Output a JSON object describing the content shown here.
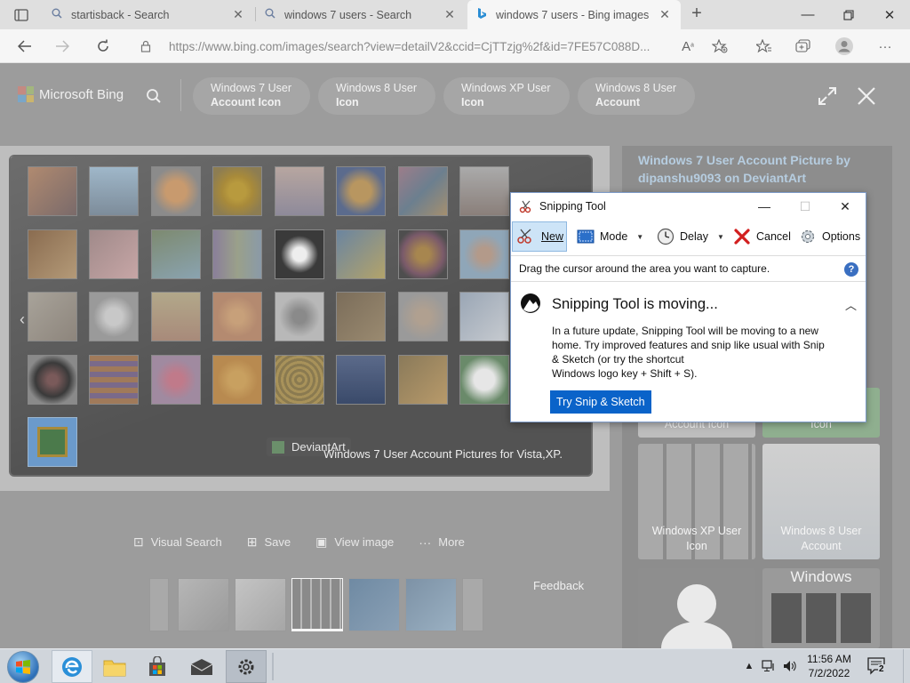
{
  "browser": {
    "tabs": [
      {
        "title": "startisback - Search",
        "active": false
      },
      {
        "title": "windows 7 users - Search",
        "active": false
      },
      {
        "title": "windows 7 users - Bing images",
        "active": true
      }
    ],
    "url": "https://www.bing.com/images/search?view=detailV2&ccid=CjTTzjg%2f&id=7FE57C088D..."
  },
  "bing": {
    "logo_text": "Microsoft Bing",
    "related": [
      {
        "line1": "Windows 7 User",
        "line2": "Account Icon"
      },
      {
        "line1": "Windows 8 User",
        "line2": "Icon"
      },
      {
        "line1": "Windows XP User",
        "line2": "Icon"
      },
      {
        "line1": "Windows 8 User",
        "line2": "Account"
      }
    ],
    "image": {
      "source": "DeviantArt",
      "caption": "Windows 7 User Account Pictures for Vista,XP."
    },
    "actions": {
      "visual_search": "Visual Search",
      "save": "Save",
      "view_image": "View image",
      "more": "More"
    },
    "feedback": "Feedback",
    "side": {
      "title": "Windows 7 User Account Picture by dipanshu9093 on DeviantArt",
      "cards": [
        {
          "label1": "Account Icon",
          "label2": ""
        },
        {
          "label1": "Icon",
          "label2": ""
        },
        {
          "label1": "Windows XP User",
          "label2": "Icon"
        },
        {
          "label1": "Windows 8 User",
          "label2": "Account"
        },
        {
          "label1": "",
          "label2": ""
        },
        {
          "label1": "Windows",
          "label2": ""
        }
      ]
    }
  },
  "snipping_tool": {
    "title": "Snipping Tool",
    "toolbar": {
      "new": "New",
      "mode": "Mode",
      "delay": "Delay",
      "cancel": "Cancel",
      "options": "Options"
    },
    "hint": "Drag the cursor around the area you want to capture.",
    "moving_title": "Snipping Tool is moving...",
    "moving_body": [
      "In a future update, Snipping Tool will be moving to a new",
      "home. Try improved features and snip like usual with Snip",
      "& Sketch (or try the shortcut",
      "Windows logo key + Shift + S)."
    ],
    "try_button": "Try Snip & Sketch"
  },
  "taskbar": {
    "time": "11:56 AM",
    "date": "7/2/2022",
    "notification_count": "2"
  },
  "colors": {
    "accent": "#0a63c9",
    "dim_overlay": "#9c9c9c",
    "side_title": "#b6cde0"
  }
}
